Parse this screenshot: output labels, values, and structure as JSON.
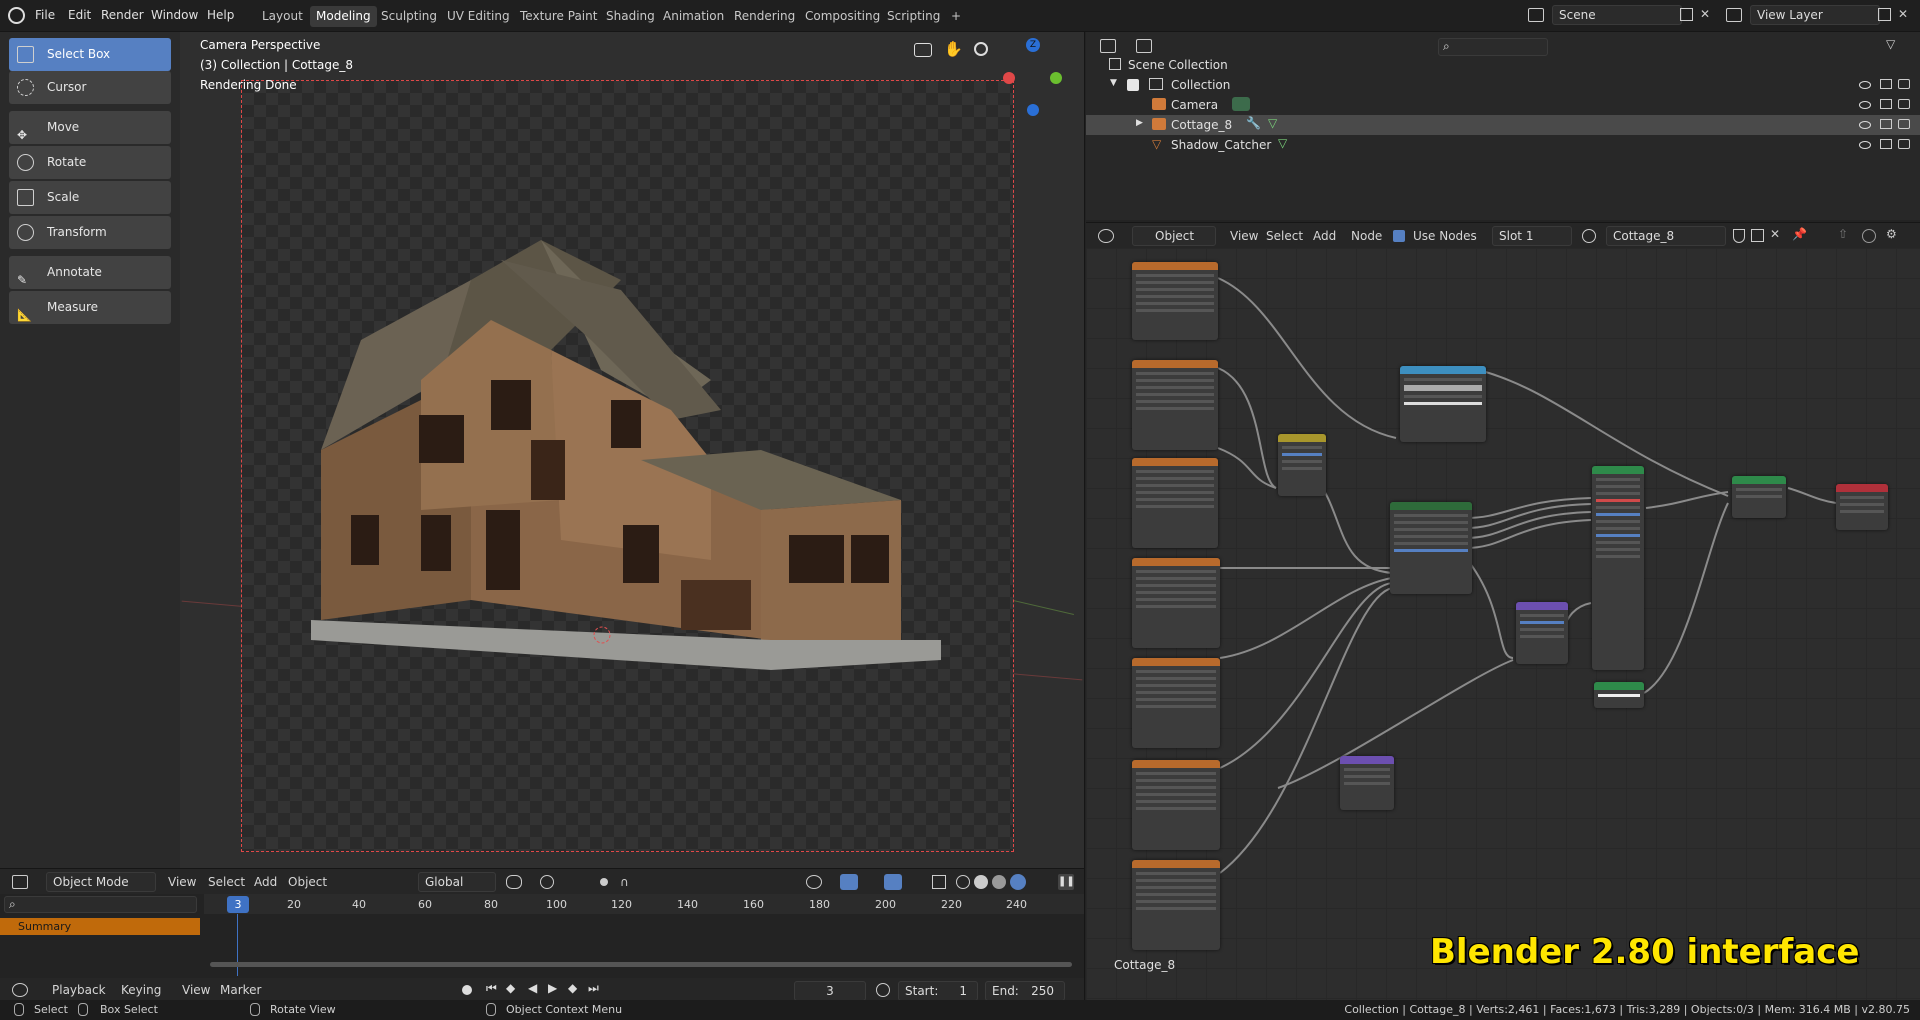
{
  "menu": [
    "File",
    "Edit",
    "Render",
    "Window",
    "Help"
  ],
  "workspaces": [
    "Layout",
    "Modeling",
    "Sculpting",
    "UV Editing",
    "Texture Paint",
    "Shading",
    "Animation",
    "Rendering",
    "Compositing",
    "Scripting"
  ],
  "active_workspace": "Modeling",
  "add_workspace": "+",
  "scene": "Scene",
  "view_layer": "View Layer",
  "tools": [
    "Select Box",
    "Cursor",
    "Move",
    "Rotate",
    "Scale",
    "Transform",
    "Annotate",
    "Measure"
  ],
  "viewport": {
    "line1": "Camera Perspective",
    "line2": "(3) Collection | Cottage_8",
    "line3": "Rendering Done"
  },
  "vp_header": {
    "mode": "Object Mode",
    "view": "View",
    "select": "Select",
    "add": "Add",
    "object": "Object",
    "orientation": "Global"
  },
  "timeline": {
    "current_frame": "3",
    "ticks": [
      "20",
      "40",
      "60",
      "80",
      "100",
      "120",
      "140",
      "160",
      "180",
      "200",
      "220",
      "240"
    ],
    "summary": "Summary",
    "playback": "Playback",
    "keying": "Keying",
    "view": "View",
    "marker": "Marker",
    "frame_field": "3",
    "start_label": "Start:",
    "start": "1",
    "end_label": "End:",
    "end": "250"
  },
  "outliner": {
    "scene_collection": "Scene Collection",
    "collection": "Collection",
    "items": [
      "Camera",
      "Cottage_8",
      "Shadow_Catcher"
    ]
  },
  "node_header": {
    "type": "Object",
    "view": "View",
    "select": "Select",
    "add": "Add",
    "node": "Node",
    "use_nodes": "Use Nodes",
    "slot": "Slot 1",
    "material": "Cottage_8"
  },
  "node_editor": {
    "material_label": "Cottage_8",
    "watermark": "Blender 2.80 interface"
  },
  "status": {
    "select": "Select",
    "box_select": "Box Select",
    "rotate_view": "Rotate View",
    "context_menu": "Object Context Menu",
    "stats": "Collection | Cottage_8 | Verts:2,461 | Faces:1,673 | Tris:3,289 | Objects:0/3 | Mem: 316.4 MB | v2.80.75"
  },
  "colors": {
    "accent": "#5680c2",
    "summary_bar": "#c06a0b",
    "camera_frame": "#e04848",
    "watermark": "#ffe600"
  }
}
